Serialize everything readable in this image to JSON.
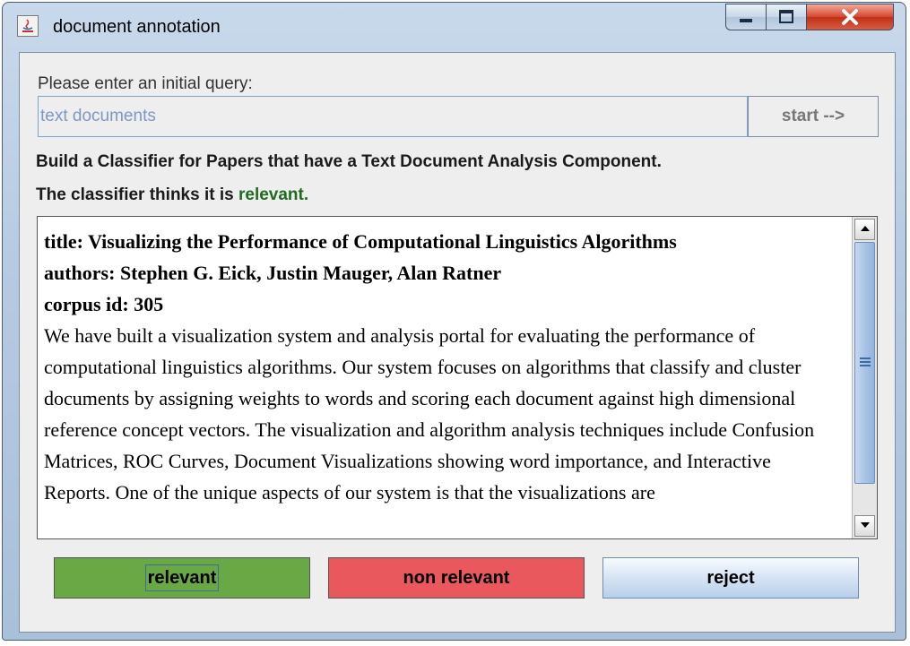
{
  "window": {
    "title": "document annotation"
  },
  "query": {
    "label": "Please enter an initial query:",
    "value": "text documents",
    "start_label": "start -->"
  },
  "task": "Build a Classifier for Papers that have a Text Document Analysis Component.",
  "classifier": {
    "prefix": "The classifier thinks it is",
    "verdict": "relevant."
  },
  "document": {
    "title": "title: Visualizing the Performance of Computational Linguistics Algorithms",
    "authors": "authors: Stephen G. Eick, Justin Mauger, Alan Ratner",
    "corpus_id": "corpus id: 305",
    "abstract": "We have built a visualization system and analysis portal for evaluating the performance of computational linguistics algorithms. Our system focuses on algorithms that classify and cluster documents by assigning weights to words and scoring each document against high dimensional reference concept vectors. The visualization and algorithm analysis techniques include Confusion Matrices, ROC Curves, Document Visualizations showing word importance, and Interactive Reports. One of the unique aspects of our system is that the visualizations are"
  },
  "buttons": {
    "relevant": "relevant",
    "non_relevant": "non relevant",
    "reject": "reject"
  },
  "colors": {
    "relevant": "#6aa745",
    "non_relevant": "#e8585c",
    "verdict_text": "#1f6b1f"
  }
}
